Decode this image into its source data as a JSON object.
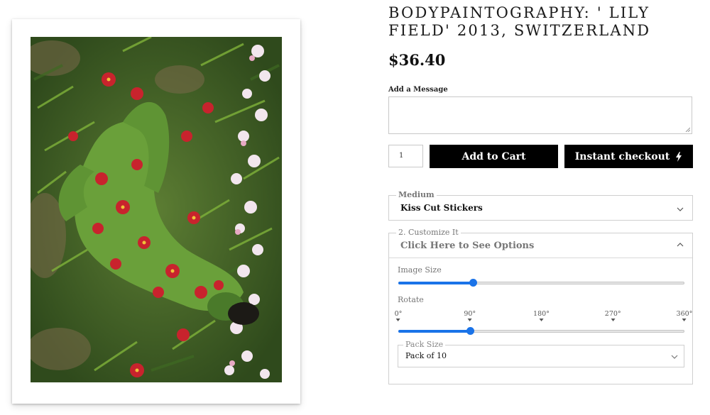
{
  "product": {
    "title": "BODYPAINTOGRAPHY: ' LILY FIELD' 2013, SWITZERLAND",
    "price": "$36.40",
    "image_alt": "Body painted figure lying in a field of lilies"
  },
  "message": {
    "label": "Add a Message",
    "value": ""
  },
  "purchase": {
    "quantity": "1",
    "add_to_cart_label": "Add to Cart",
    "instant_checkout_label": "Instant checkout"
  },
  "medium": {
    "legend": "Medium",
    "selected": "Kiss Cut Stickers"
  },
  "customize": {
    "legend": "2. Customize It",
    "toggle_label": "Click Here to See Options",
    "image_size_label": "Image Size",
    "image_size_fraction": 0.26,
    "rotate_label": "Rotate",
    "rotate_ticks": [
      "0°",
      "90°",
      "180°",
      "270°",
      "360°"
    ],
    "rotate_value_deg": 90,
    "pack_size_legend": "Pack Size",
    "pack_size_selected": "Pack of 10"
  },
  "colors": {
    "accent": "#1a73e8",
    "button_bg": "#000000",
    "muted_text": "#777777"
  }
}
